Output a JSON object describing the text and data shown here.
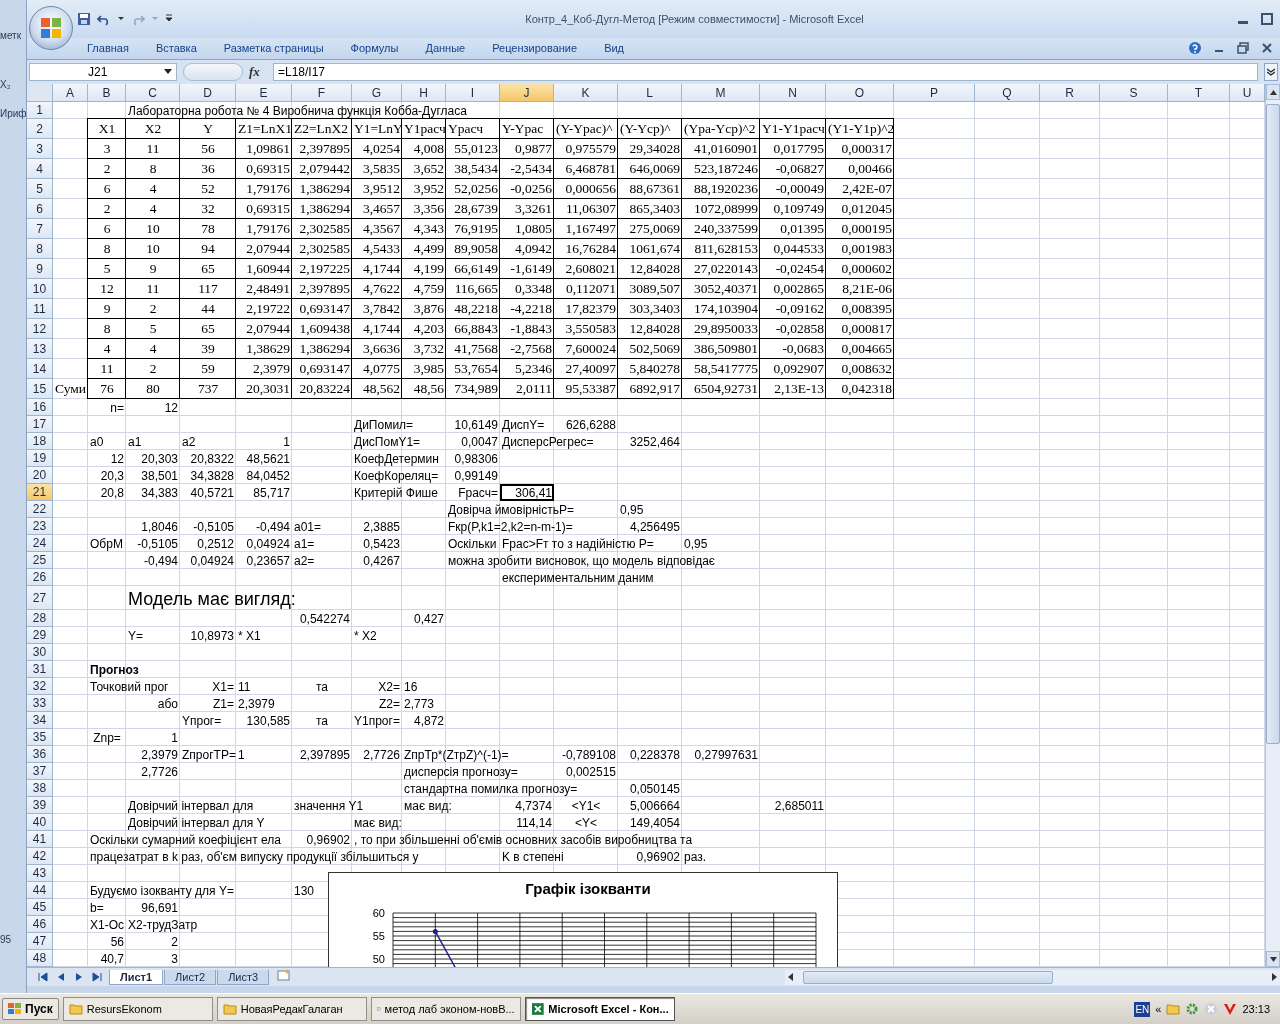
{
  "background_window": {
    "texts": [
      "метк",
      "X₂",
      "Ириф",
      "95"
    ]
  },
  "window": {
    "title": "Контр_4_Коб-Дугл-Метод  [Режим совместимости] - Microsoft Excel"
  },
  "ribbon_tabs": [
    {
      "label": "Главная",
      "selected": false
    },
    {
      "label": "Вставка",
      "selected": false
    },
    {
      "label": "Разметка страницы",
      "selected": false
    },
    {
      "label": "Формулы",
      "selected": false
    },
    {
      "label": "Данные",
      "selected": false
    },
    {
      "label": "Рецензирование",
      "selected": false
    },
    {
      "label": "Вид",
      "selected": false
    }
  ],
  "formula_bar": {
    "name_box": "J21",
    "function_label": "fx",
    "formula": "=L18/I17"
  },
  "columns": [
    {
      "label": "A",
      "selected": false
    },
    {
      "label": "B",
      "selected": false
    },
    {
      "label": "C",
      "selected": false
    },
    {
      "label": "D",
      "selected": false
    },
    {
      "label": "E",
      "selected": false
    },
    {
      "label": "F",
      "selected": false
    },
    {
      "label": "G",
      "selected": false
    },
    {
      "label": "H",
      "selected": false
    },
    {
      "label": "I",
      "selected": false
    },
    {
      "label": "J",
      "selected": true
    },
    {
      "label": "K",
      "selected": false
    },
    {
      "label": "L",
      "selected": false
    },
    {
      "label": "M",
      "selected": false
    },
    {
      "label": "N",
      "selected": false
    },
    {
      "label": "O",
      "selected": false
    },
    {
      "label": "P",
      "selected": false
    },
    {
      "label": "Q",
      "selected": false
    },
    {
      "label": "R",
      "selected": false
    },
    {
      "label": "S",
      "selected": false
    },
    {
      "label": "T",
      "selected": false
    },
    {
      "label": "U",
      "selected": false
    }
  ],
  "rows": [
    {
      "label": "1",
      "selected": false,
      "kind": "plain",
      "cells": {
        "C": "Лабораторна робота № 4 Виробнича  функція Кобба-Дугласа"
      }
    },
    {
      "label": "2",
      "selected": false,
      "kind": "table",
      "cells": {
        "B": "X1",
        "C": "X2",
        "D": "Y",
        "E": "Z1=LnX1",
        "F": "Z2=LnX2",
        "G": "Y1=LnY",
        "H": "Y1расч",
        "I": "Yрасч",
        "J": "Y-Yрас",
        "K": "(Y-Yрас)^",
        "L": "(Y-Yср)^",
        "M": "(Yра-Yср)^2",
        "N": "Y1-Y1расч",
        "O": "(Y1-Y1р)^2"
      }
    },
    {
      "label": "3",
      "selected": false,
      "kind": "table",
      "cells": {
        "B": "3",
        "C": "11",
        "D": "56",
        "E": "1,09861",
        "F": "2,397895",
        "G": "4,0254",
        "H": "4,008",
        "I": "55,0123",
        "J": "0,9877",
        "K": "0,975579",
        "L": "29,34028",
        "M": "41,0160901",
        "N": "0,017795",
        "O": "0,000317"
      }
    },
    {
      "label": "4",
      "selected": false,
      "kind": "table",
      "cells": {
        "B": "2",
        "C": "8",
        "D": "36",
        "E": "0,69315",
        "F": "2,079442",
        "G": "3,5835",
        "H": "3,652",
        "I": "38,5434",
        "J": "-2,5434",
        "K": "6,468781",
        "L": "646,0069",
        "M": "523,187246",
        "N": "-0,06827",
        "O": "0,00466"
      }
    },
    {
      "label": "5",
      "selected": false,
      "kind": "table",
      "cells": {
        "B": "6",
        "C": "4",
        "D": "52",
        "E": "1,79176",
        "F": "1,386294",
        "G": "3,9512",
        "H": "3,952",
        "I": "52,0256",
        "J": "-0,0256",
        "K": "0,000656",
        "L": "88,67361",
        "M": "88,1920236",
        "N": "-0,00049",
        "O": "2,42E-07"
      }
    },
    {
      "label": "6",
      "selected": false,
      "kind": "table",
      "cells": {
        "B": "2",
        "C": "4",
        "D": "32",
        "E": "0,69315",
        "F": "1,386294",
        "G": "3,4657",
        "H": "3,356",
        "I": "28,6739",
        "J": "3,3261",
        "K": "11,06307",
        "L": "865,3403",
        "M": "1072,08999",
        "N": "0,109749",
        "O": "0,012045"
      }
    },
    {
      "label": "7",
      "selected": false,
      "kind": "table",
      "cells": {
        "B": "6",
        "C": "10",
        "D": "78",
        "E": "1,79176",
        "F": "2,302585",
        "G": "4,3567",
        "H": "4,343",
        "I": "76,9195",
        "J": "1,0805",
        "K": "1,167497",
        "L": "275,0069",
        "M": "240,337599",
        "N": "0,01395",
        "O": "0,000195"
      }
    },
    {
      "label": "8",
      "selected": false,
      "kind": "table",
      "cells": {
        "B": "8",
        "C": "10",
        "D": "94",
        "E": "2,07944",
        "F": "2,302585",
        "G": "4,5433",
        "H": "4,499",
        "I": "89,9058",
        "J": "4,0942",
        "K": "16,76284",
        "L": "1061,674",
        "M": "811,628153",
        "N": "0,044533",
        "O": "0,001983"
      }
    },
    {
      "label": "9",
      "selected": false,
      "kind": "table",
      "cells": {
        "B": "5",
        "C": "9",
        "D": "65",
        "E": "1,60944",
        "F": "2,197225",
        "G": "4,1744",
        "H": "4,199",
        "I": "66,6149",
        "J": "-1,6149",
        "K": "2,608021",
        "L": "12,84028",
        "M": "27,0220143",
        "N": "-0,02454",
        "O": "0,000602"
      }
    },
    {
      "label": "10",
      "selected": false,
      "kind": "table",
      "cells": {
        "B": "12",
        "C": "11",
        "D": "117",
        "E": "2,48491",
        "F": "2,397895",
        "G": "4,7622",
        "H": "4,759",
        "I": "116,665",
        "J": "0,3348",
        "K": "0,112071",
        "L": "3089,507",
        "M": "3052,40371",
        "N": "0,002865",
        "O": "8,21E-06"
      }
    },
    {
      "label": "11",
      "selected": false,
      "kind": "table",
      "cells": {
        "B": "9",
        "C": "2",
        "D": "44",
        "E": "2,19722",
        "F": "0,693147",
        "G": "3,7842",
        "H": "3,876",
        "I": "48,2218",
        "J": "-4,2218",
        "K": "17,82379",
        "L": "303,3403",
        "M": "174,103904",
        "N": "-0,09162",
        "O": "0,008395"
      }
    },
    {
      "label": "12",
      "selected": false,
      "kind": "table",
      "cells": {
        "B": "8",
        "C": "5",
        "D": "65",
        "E": "2,07944",
        "F": "1,609438",
        "G": "4,1744",
        "H": "4,203",
        "I": "66,8843",
        "J": "-1,8843",
        "K": "3,550583",
        "L": "12,84028",
        "M": "29,8950033",
        "N": "-0,02858",
        "O": "0,000817"
      }
    },
    {
      "label": "13",
      "selected": false,
      "kind": "table",
      "cells": {
        "B": "4",
        "C": "4",
        "D": "39",
        "E": "1,38629",
        "F": "1,386294",
        "G": "3,6636",
        "H": "3,732",
        "I": "41,7568",
        "J": "-2,7568",
        "K": "7,600024",
        "L": "502,5069",
        "M": "386,509801",
        "N": "-0,0683",
        "O": "0,004665"
      }
    },
    {
      "label": "14",
      "selected": false,
      "kind": "table",
      "cells": {
        "B": "11",
        "C": "2",
        "D": "59",
        "E": "2,3979",
        "F": "0,693147",
        "G": "4,0775",
        "H": "3,985",
        "I": "53,7654",
        "J": "5,2346",
        "K": "27,40097",
        "L": "5,840278",
        "M": "58,5417775",
        "N": "0,092907",
        "O": "0,008632"
      }
    },
    {
      "label": "15",
      "selected": false,
      "kind": "table",
      "cells": {
        "A": "Суми",
        "B": "76",
        "C": "80",
        "D": "737",
        "E": "20,3031",
        "F": "20,83224",
        "G": "48,562",
        "H": "48,56",
        "I": "734,989",
        "J": "2,0111",
        "K": "95,53387",
        "L": "6892,917",
        "M": "6504,92731",
        "N": "2,13E-13",
        "O": "0,042318"
      }
    },
    {
      "label": "16",
      "selected": false,
      "kind": "plain",
      "cells": {
        "B": "n=",
        "C": "12"
      }
    },
    {
      "label": "17",
      "selected": false,
      "kind": "plain",
      "cells": {
        "G": "ДиПомил=",
        "I": "10,6149",
        "J": "ДиспY=",
        "K": "626,6288"
      }
    },
    {
      "label": "18",
      "selected": false,
      "kind": "plain",
      "cells": {
        "B": "a0",
        "C": "a1",
        "D": "a2",
        "E": "1",
        "G": "ДисПомY1=",
        "I": "0,0047",
        "J": "ДисперсРегрес=",
        "L": "3252,464"
      }
    },
    {
      "label": "19",
      "selected": false,
      "kind": "plain",
      "cells": {
        "B": "12",
        "C": "20,303",
        "D": "20,8322",
        "E": "48,5621",
        "G": "КоефДетермин",
        "I": "0,98306"
      }
    },
    {
      "label": "20",
      "selected": false,
      "kind": "plain",
      "cells": {
        "B": "20,3",
        "C": "38,501",
        "D": "34,3828",
        "E": "84,0452",
        "G": "КоефКореляц=",
        "I": "0,99149"
      }
    },
    {
      "label": "21",
      "selected": true,
      "kind": "plain",
      "cells": {
        "B": "20,8",
        "C": "34,383",
        "D": "40,5721",
        "E": "85,717",
        "G": "Критерій Фише",
        "I": "Fрасч=",
        "J": "306,41"
      }
    },
    {
      "label": "22",
      "selected": false,
      "kind": "plain",
      "cells": {
        "I": "Довірча ймовірністьP=",
        "L": "0,95"
      }
    },
    {
      "label": "23",
      "selected": false,
      "kind": "plain",
      "cells": {
        "C": "1,8046",
        "D": "-0,5105",
        "E": "-0,494",
        "F": "a01=",
        "G": "2,3885",
        "I": "Fкр(P,k1=2,k2=n-m-1)=",
        "L": "4,256495"
      }
    },
    {
      "label": "24",
      "selected": false,
      "kind": "plain",
      "cells": {
        "B": "ОбрМ",
        "C": "-0,5105",
        "D": "0,2512",
        "E": "0,04924",
        "F": "a1=",
        "G": "0,5423",
        "I": "Оскільки",
        "J": "Fрас>Fт то з надійністю P=",
        "M": "0,95"
      }
    },
    {
      "label": "25",
      "selected": false,
      "kind": "plain",
      "cells": {
        "C": "-0,494",
        "D": "0,04924",
        "E": "0,23657",
        "F": "a2=",
        "G": "0,4267",
        "I": "можна зробити висновок, що модель відповідає"
      }
    },
    {
      "label": "26",
      "selected": false,
      "kind": "plain",
      "cells": {
        "J": "експериментальним даним"
      }
    },
    {
      "label": "27",
      "selected": false,
      "kind": "heading",
      "cells": {
        "C": "Модель має вигляд:"
      }
    },
    {
      "label": "28",
      "selected": false,
      "kind": "plain",
      "cells": {
        "F": "0,542274",
        "H": "0,427"
      }
    },
    {
      "label": "29",
      "selected": false,
      "kind": "plain",
      "cells": {
        "C": "Y=",
        "D": "10,8973",
        "E": "*   X1",
        "G": "*  X2"
      }
    },
    {
      "label": "30",
      "selected": false,
      "kind": "plain",
      "cells": {}
    },
    {
      "label": "31",
      "selected": false,
      "kind": "bold",
      "cells": {
        "B": "Прогноз"
      }
    },
    {
      "label": "32",
      "selected": false,
      "kind": "plain",
      "cells": {
        "B": "Точковий прог",
        "D": "X1=",
        "E": "11",
        "F": "та",
        "G": "X2=",
        "H": "16"
      }
    },
    {
      "label": "33",
      "selected": false,
      "kind": "plain",
      "cells": {
        "C": "або",
        "D": "Z1=",
        "E": "2,3979",
        "G": "Z2=",
        "H": "2,773"
      }
    },
    {
      "label": "34",
      "selected": false,
      "kind": "plain",
      "cells": {
        "D": "Yпрог=",
        "E": "130,585",
        "F": "та",
        "G": "Y1прог=",
        "H": "4,872"
      }
    },
    {
      "label": "35",
      "selected": false,
      "kind": "plain",
      "cells": {
        "B": "Znp=",
        "C": "1"
      }
    },
    {
      "label": "36",
      "selected": false,
      "kind": "plain",
      "cells": {
        "C": "2,3979",
        "D": "ZпрогТР=",
        "E": "1",
        "F": "2,397895",
        "G": "2,7726",
        "H": "ZпрТр*(ZтрZ)^(-1)=",
        "K": "-0,789108",
        "L": "0,228378",
        "M": "0,27997631"
      }
    },
    {
      "label": "37",
      "selected": false,
      "kind": "plain",
      "cells": {
        "C": "2,7726",
        "H": "дисперсія прогнозу=",
        "K": "0,002515"
      }
    },
    {
      "label": "38",
      "selected": false,
      "kind": "plain",
      "cells": {
        "H": "стандартна помилка прогнозу=",
        "L": "0,050145"
      }
    },
    {
      "label": "39",
      "selected": false,
      "kind": "plain",
      "cells": {
        "C": "Довірчий інтервал  для",
        "F": "значення Y1",
        "H": "має вид:",
        "J": "4,7374",
        "K": "<Y1<",
        "L": "5,006664",
        "N": "2,685011"
      }
    },
    {
      "label": "40",
      "selected": false,
      "kind": "plain",
      "cells": {
        "C": "Довірчий інтервал для Y",
        "G": "має вид:",
        "J": "114,14",
        "K": "<Y<",
        "L": "149,4054"
      }
    },
    {
      "label": "41",
      "selected": false,
      "kind": "plain",
      "cells": {
        "B": "Оскільки сумарний коефіцієнт ела",
        "F": "0,96902",
        "G": ", то при збільшенні об'ємів основних засобів виробництва та"
      }
    },
    {
      "label": "42",
      "selected": false,
      "kind": "plain",
      "cells": {
        "B": "працезатрат в k раз, об'єм випуску продукції збільшиться у",
        "J": "K  в степені",
        "L": "0,96902",
        "M": "раз."
      }
    },
    {
      "label": "43",
      "selected": false,
      "kind": "plain",
      "cells": {}
    },
    {
      "label": "44",
      "selected": false,
      "kind": "plain",
      "cells": {
        "B": "Будуємо ізокванту для Y=",
        "F": "130"
      }
    },
    {
      "label": "45",
      "selected": false,
      "kind": "plain",
      "cells": {
        "B": "b=",
        "C": "96,691"
      }
    },
    {
      "label": "46",
      "selected": false,
      "kind": "plain",
      "cells": {
        "B": "X1-Ос",
        "C": "X2-трудЗатр"
      }
    },
    {
      "label": "47",
      "selected": false,
      "kind": "plain",
      "cells": {
        "B": "56",
        "C": "2"
      }
    },
    {
      "label": "48",
      "selected": false,
      "kind": "plain",
      "cells": {
        "B": "40,7",
        "C": "3"
      }
    }
  ],
  "chart": {
    "title": "Графік ізокванти",
    "tick_labels": [
      "60",
      "55",
      "50"
    ]
  },
  "sheet_tabs": [
    {
      "label": "Лист1",
      "selected": true
    },
    {
      "label": "Лист2",
      "selected": false
    },
    {
      "label": "Лист3",
      "selected": false
    }
  ],
  "taskbar": {
    "start": "Пуск",
    "buttons": [
      {
        "label": "ResursEkonom",
        "selected": false,
        "kind": "folder"
      },
      {
        "label": "НоваяРедакГалаган",
        "selected": false,
        "kind": "folder"
      },
      {
        "label": "метод лаб эконом-новВ...",
        "selected": false,
        "kind": "word"
      },
      {
        "label": "Microsoft Excel - Кон...",
        "selected": true,
        "kind": "excel"
      }
    ],
    "language": "EN",
    "tray_toggle": "«",
    "clock": "23:13"
  }
}
